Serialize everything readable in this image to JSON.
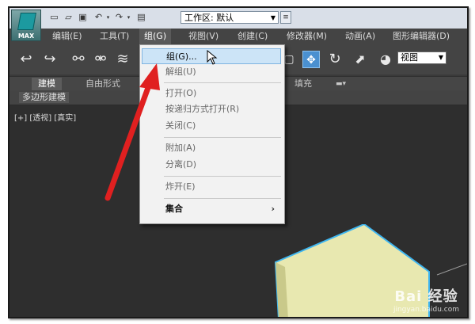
{
  "titlebar": {
    "app_logo_text": "MAX",
    "workspace_label": "工作区: 默认"
  },
  "menubar": {
    "items": [
      "编辑(E)",
      "工具(T)",
      "组(G)",
      "视图(V)",
      "创建(C)",
      "修改器(M)",
      "动画(A)",
      "图形编辑器(D)"
    ]
  },
  "toolbar": {
    "view_select_value": "视图"
  },
  "ribbon": {
    "tabs": [
      "建模",
      "自由形式",
      "填充"
    ],
    "panel_label": "多边形建模"
  },
  "viewport": {
    "label": "[+] [透视] [真实]",
    "box_color": "#e8e8b0",
    "outline_color": "#3fb6f0"
  },
  "group_menu": {
    "items": [
      {
        "label": "组(G)...",
        "state": "highlighted"
      },
      {
        "label": "解组(U)",
        "state": "disabled"
      },
      {
        "label": "打开(O)",
        "state": "disabled"
      },
      {
        "label": "按递归方式打开(R)",
        "state": "disabled"
      },
      {
        "label": "关闭(C)",
        "state": "disabled"
      },
      {
        "label": "附加(A)",
        "state": "disabled"
      },
      {
        "label": "分离(D)",
        "state": "disabled"
      },
      {
        "label": "炸开(E)",
        "state": "disabled"
      },
      {
        "label": "集合",
        "state": "submenu"
      }
    ]
  },
  "watermark": {
    "logo": "Bai 经验",
    "url": "jingyan.baidu.com"
  },
  "annotation": {
    "arrow_color": "#e02020"
  }
}
